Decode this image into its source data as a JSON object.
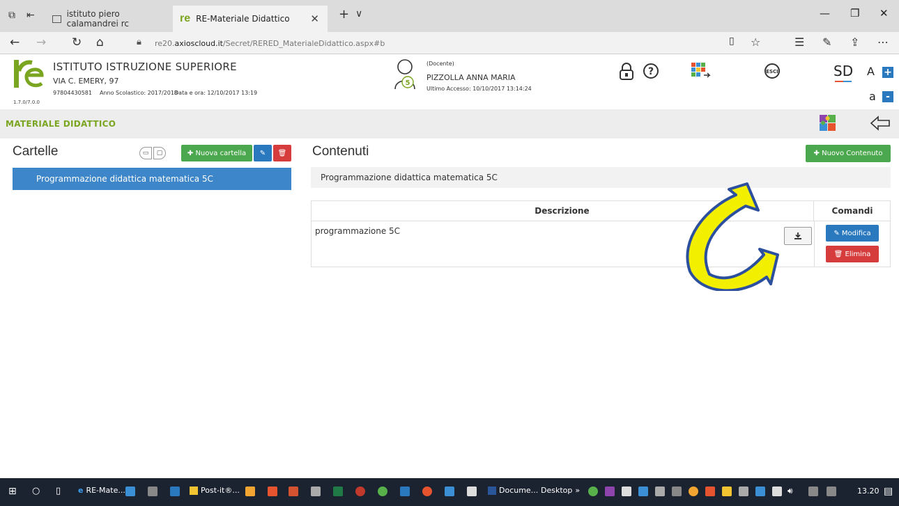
{
  "browser": {
    "tab_inactive_label": "istituto piero calamandrei rc",
    "tab_active_label": "RE-Materiale Didattico",
    "tab_close": "✕",
    "new_tab": "+",
    "tab_menu": "∨",
    "win_min": "—",
    "win_max": "❐",
    "win_close": "✕",
    "url_domain_prefix": "re20.",
    "url_domain": "axioscloud.it",
    "url_path": "/Secret/RERED_MaterialeDidattico.aspx#b"
  },
  "header": {
    "version": "1.7.0/7.0.0",
    "school_name": "ISTITUTO ISTRUZIONE SUPERIORE",
    "school_address": "VIA C. EMERY, 97",
    "school_code": "97804430581",
    "school_year": "Anno Scolastico: 2017/2018",
    "datetime": "Data e ora: 12/10/2017 13:19",
    "user_role": "(Docente)",
    "user_name": "PIZZOLLA ANNA MARIA",
    "last_access": "Ultimo Accesso: 10/10/2017 13:14:24",
    "avatar_number": "5",
    "font_big": "A",
    "font_small": "a",
    "font_plus": "+",
    "font_minus": "-",
    "exit_label": "ESCI",
    "sd_label": "SD"
  },
  "section": {
    "title": "MATERIALE DIDATTICO"
  },
  "folders": {
    "title": "Cartelle",
    "new_folder": "✚ Nuova cartella",
    "items": [
      "Programmazione didattica matematica 5C"
    ]
  },
  "contents": {
    "title": "Contenuti",
    "new_content": "✚ Nuovo Contenuto",
    "path": "Programmazione didattica matematica 5C",
    "col_description": "Descrizione",
    "col_commands": "Comandi",
    "rows": [
      {
        "description": "programmazione 5C",
        "edit": "✎ Modifica",
        "delete": "🗑 Elimina"
      }
    ]
  },
  "taskbar": {
    "item_browser": "RE-Mate...",
    "item_postit": "Post-it®...",
    "item_word": "Docume...",
    "desktop": "Desktop",
    "more": "»",
    "clock": "13.20"
  },
  "colors": {
    "green": "#4ca84e",
    "blue": "#2a79bf",
    "red": "#d63c3c",
    "brand_green": "#7aa520",
    "arrow_yellow": "#f2ef00",
    "arrow_blue": "#2c4f9e"
  }
}
